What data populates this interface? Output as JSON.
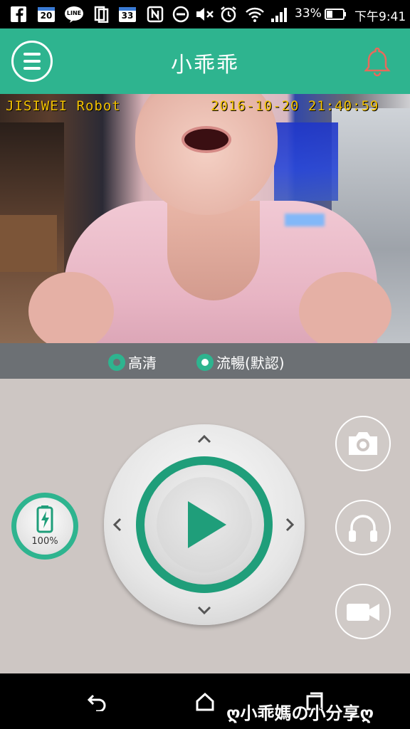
{
  "status_bar": {
    "notification_badge_calendar": "20",
    "notification_badge_other": "33",
    "line_label": "LINE",
    "battery_percent": "33%",
    "time": "下午9:41"
  },
  "app_bar": {
    "title": "小乖乖"
  },
  "video": {
    "osd_label": "JISIWEI Robot",
    "osd_timestamp": "2016-10-20 21:40:59"
  },
  "quality": {
    "options": [
      {
        "label": "高清",
        "selected": false
      },
      {
        "label": "流暢(默認)",
        "selected": true
      }
    ]
  },
  "controls": {
    "battery_label": "100%",
    "battery_level": 1.0
  },
  "watermark": "ღ小乖媽の小分享ღ",
  "colors": {
    "accent": "#2eb48f",
    "accent_dark": "#1f9e7a",
    "control_bg": "#cdc6c3",
    "quality_bar": "#6c7074",
    "osd_text": "#f2c100"
  },
  "icons": {
    "menu": "hamburger-menu-icon",
    "bell": "bell-icon",
    "battery": "battery-charging-icon",
    "play": "play-icon",
    "camera": "camera-icon",
    "headphones": "headphones-icon",
    "video": "video-camera-icon"
  }
}
